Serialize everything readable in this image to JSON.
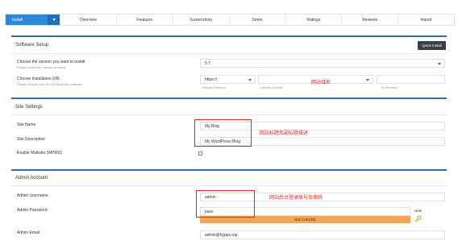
{
  "tabs": [
    {
      "label": "Install"
    },
    {
      "label": "Overview"
    },
    {
      "label": "Features"
    },
    {
      "label": "Screenshots"
    },
    {
      "label": "Demo"
    },
    {
      "label": "Ratings"
    },
    {
      "label": "Reviews"
    },
    {
      "label": "Import"
    }
  ],
  "software_setup": {
    "title": "Software Setup",
    "quick_install_label": "Quick Install",
    "version_label": "Choose the version you want to install",
    "version_sublabel": "Please select the version to install",
    "version_value": "5.7",
    "url_label": "Choose Installation URL",
    "url_sublabel": "Please choose the URL to install the software",
    "protocol_value": "https://",
    "protocol_hint": "Choose Protocol",
    "domain_hint": "Choose Domain",
    "directory_hint": "In Directory",
    "domain_note": "网站域名"
  },
  "site_settings": {
    "title": "Site Settings",
    "name_label": "Site Name",
    "name_value": "My Blog",
    "desc_label": "Site Description",
    "desc_value": "My WordPress Blog",
    "multisite_label": "Enable Multisite (WPMU)",
    "note": "网站标题及副标题描述"
  },
  "admin_account": {
    "title": "Admin Account",
    "username_label": "Admin Username",
    "username_value": "admin",
    "password_label": "Admin Password",
    "password_value": "pass",
    "hide_label": "Hide",
    "strength_label": "Bad (18/100)",
    "email_label": "Admin Email",
    "email_value": "admin@hypps.top",
    "note": "网站后台登录账号及密码"
  },
  "colors": {
    "accent": "#2f88d6",
    "annotation": "#e0261f",
    "strength_bad": "#f3a65a"
  }
}
